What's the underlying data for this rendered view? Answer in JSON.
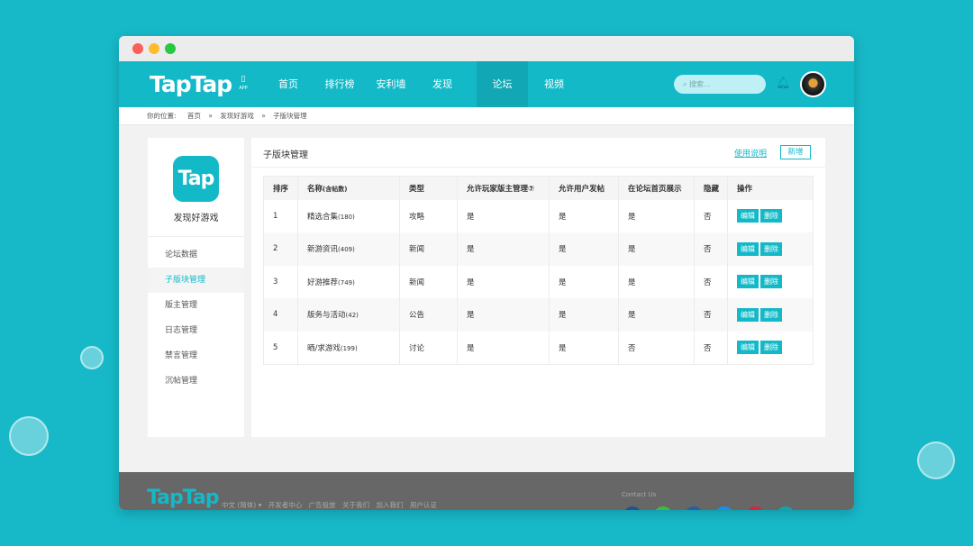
{
  "nav": {
    "logo": "TapTap",
    "app_label": "APP",
    "items": [
      "首页",
      "排行榜",
      "安利墙",
      "发现",
      "论坛",
      "视频"
    ],
    "active": "论坛",
    "search_placeholder": "搜索..."
  },
  "breadcrumb": {
    "label": "你的位置:",
    "items": [
      "首页",
      "»",
      "发现好游戏",
      "»",
      "子版块管理"
    ]
  },
  "sidebar": {
    "icon_text": "Tap",
    "game_name": "发现好游戏",
    "items": [
      "论坛数据",
      "子版块管理",
      "版主管理",
      "日志管理",
      "禁言管理",
      "沉帖管理"
    ],
    "active": "子版块管理"
  },
  "main": {
    "title": "子版块管理",
    "help_link": "使用说明",
    "add_button": "新增",
    "columns": [
      "排序",
      "名称",
      "(含帖数)",
      "类型",
      "允许玩家版主管理⑦",
      "允许用户发帖",
      "在论坛首页展示",
      "隐藏",
      "操作"
    ],
    "rows": [
      {
        "order": "1",
        "name": "精选合集",
        "count": "(180)",
        "type": "攻略",
        "moderator": "是",
        "post": "是",
        "show": "是",
        "hidden": "否"
      },
      {
        "order": "2",
        "name": "新游资讯",
        "count": "(409)",
        "type": "新闻",
        "moderator": "是",
        "post": "是",
        "show": "是",
        "hidden": "否"
      },
      {
        "order": "3",
        "name": "好游推荐",
        "count": "(749)",
        "type": "新闻",
        "moderator": "是",
        "post": "是",
        "show": "是",
        "hidden": "否"
      },
      {
        "order": "4",
        "name": "版务与活动",
        "count": "(42)",
        "type": "公告",
        "moderator": "是",
        "post": "是",
        "show": "是",
        "hidden": "否"
      },
      {
        "order": "5",
        "name": "晒/求游戏",
        "count": "(199)",
        "type": "讨论",
        "moderator": "是",
        "post": "是",
        "show": "否",
        "hidden": "否"
      }
    ],
    "edit_label": "编辑",
    "delete_label": "删除"
  },
  "footer": {
    "logo": "TapTap",
    "links": [
      "中文 (简体) ▾",
      "开发者中心",
      "广告投放",
      "关于我们",
      "加入我们",
      "用户认证"
    ],
    "contact": "Contact Us"
  },
  "colors": {
    "brand": "#14b9c8",
    "background": "#17b9c9",
    "footer": "#676767"
  }
}
